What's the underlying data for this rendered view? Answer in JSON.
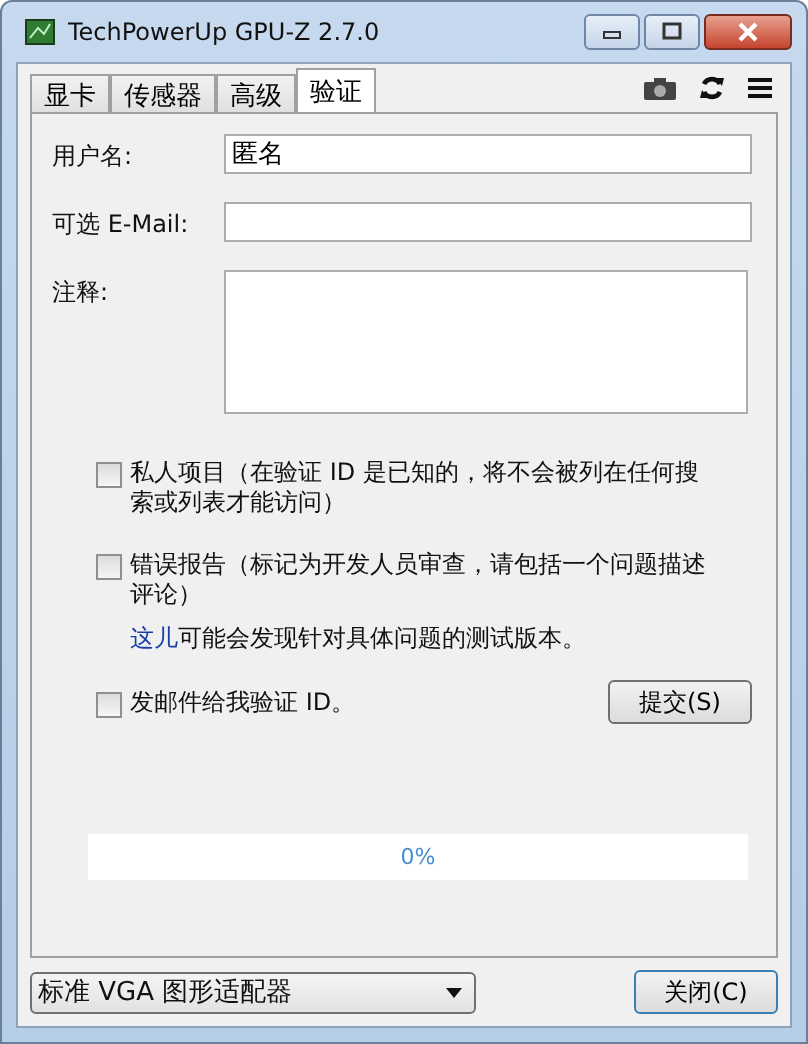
{
  "window": {
    "title": "TechPowerUp GPU-Z 2.7.0"
  },
  "tabs": [
    {
      "label": "显卡",
      "selected": false
    },
    {
      "label": "传感器",
      "selected": false
    },
    {
      "label": "高级",
      "selected": false
    },
    {
      "label": "验证",
      "selected": true
    }
  ],
  "form": {
    "fields": [
      {
        "label": "用户名:",
        "value": "匿名",
        "kind": "input"
      },
      {
        "label": "可选 E-Mail:",
        "kind": "input"
      },
      {
        "label": "注释:",
        "kind": "textarea"
      }
    ]
  },
  "options": [
    {
      "label": "私人项目（在验证 ID 是已知的，将不会被列在任何搜索或列表才能访问）",
      "checked": false
    },
    {
      "label": "错误报告（标记为开发人员审查，请包括一个问题描述评论）",
      "checked": false,
      "note_link": "这儿",
      "note": "可能会发现针对具体问题的测试版本。"
    }
  ],
  "email_option": {
    "label": "发邮件给我验证 ID。",
    "checked": false
  },
  "submit_button": "提交(S)",
  "progress": {
    "level": 0,
    "reading": "0%"
  },
  "adapter_select": {
    "value": "标准 VGA 图形适配器"
  },
  "close_button": "关闭(C)"
}
